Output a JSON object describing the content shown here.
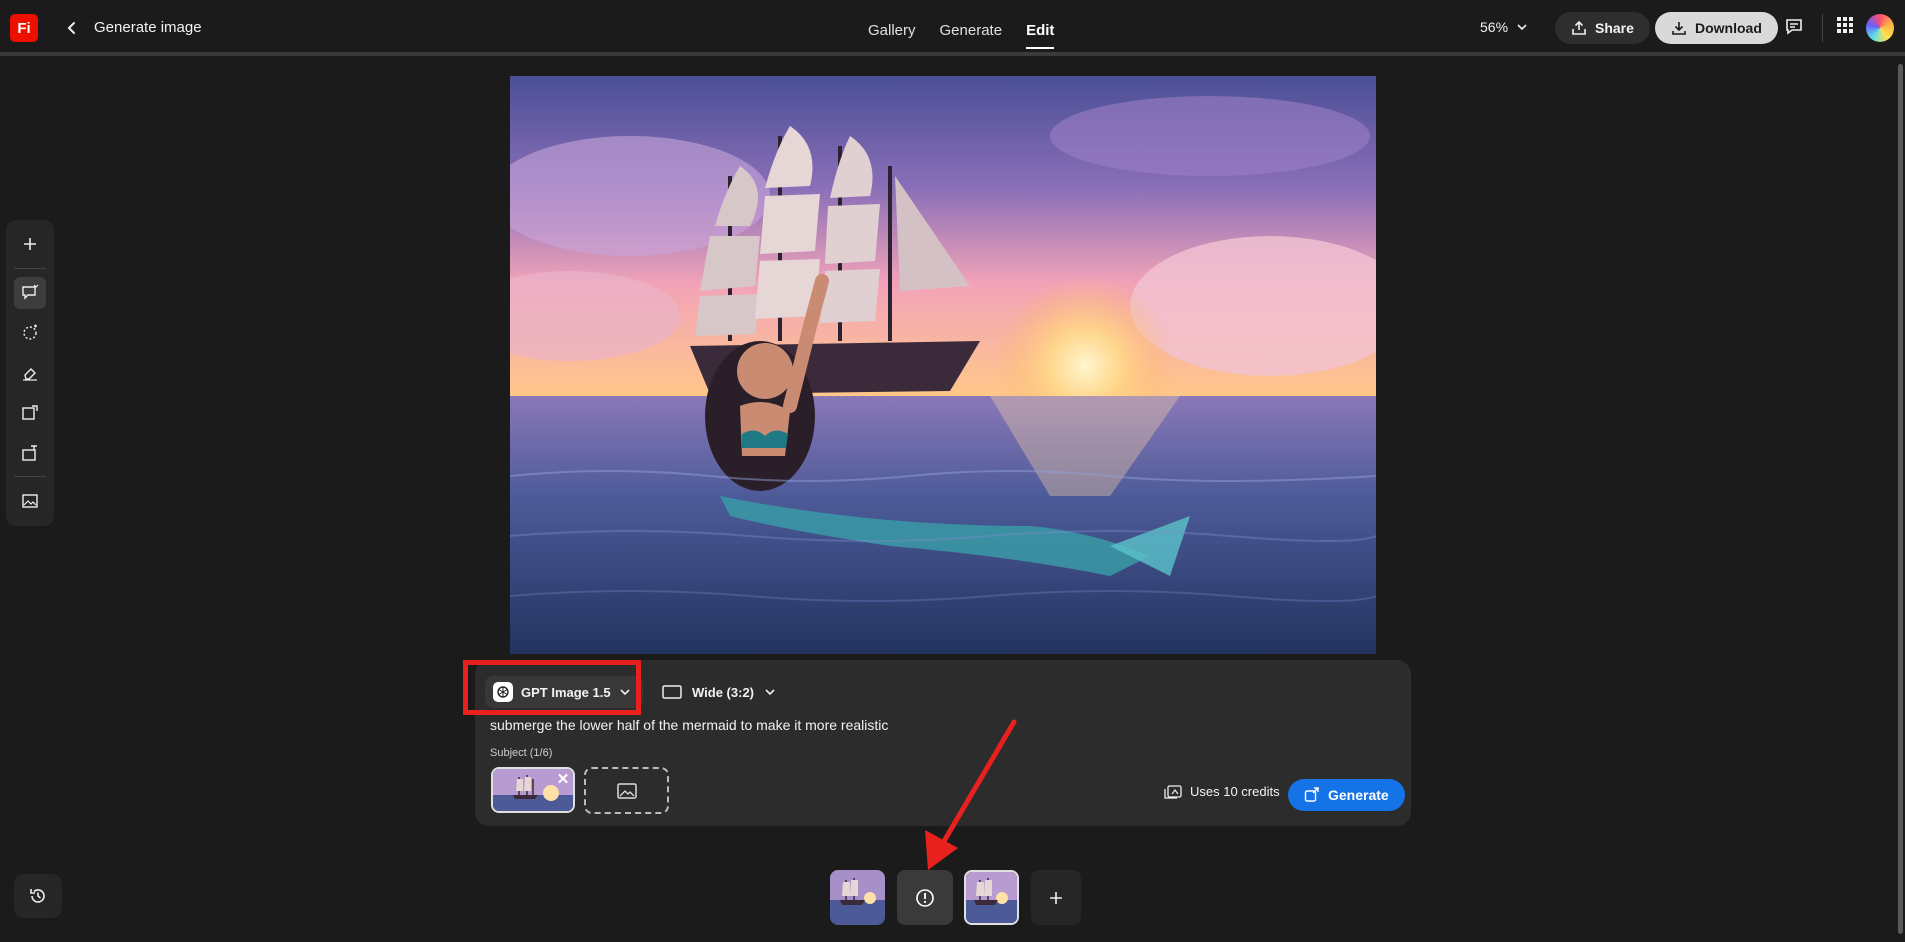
{
  "app": {
    "logo_text": "Fi",
    "page_title": "Generate image"
  },
  "nav": {
    "tabs": [
      "Gallery",
      "Generate",
      "Edit"
    ],
    "active": "Edit"
  },
  "header": {
    "zoom": "56%",
    "share_label": "Share",
    "download_label": "Download"
  },
  "toolbar": {
    "tools": [
      "add-icon",
      "prompt-edit-icon",
      "select-icon",
      "remove-icon",
      "expand-icon",
      "upscale-icon",
      "reference-image-icon"
    ],
    "active": "prompt-edit-icon"
  },
  "canvas": {
    "description_icon": "generated-image"
  },
  "prompt_panel": {
    "model": "GPT Image 1.5",
    "aspect": "Wide (3:2)",
    "prompt": "submerge the lower half of the mermaid to make it more realistic",
    "subject_label": "Subject (1/6)",
    "credits": "Uses 10 credits",
    "generate_label": "Generate"
  },
  "colors": {
    "accent": "#1473e6",
    "highlight": "#e8201e",
    "logo": "#eb1000"
  }
}
